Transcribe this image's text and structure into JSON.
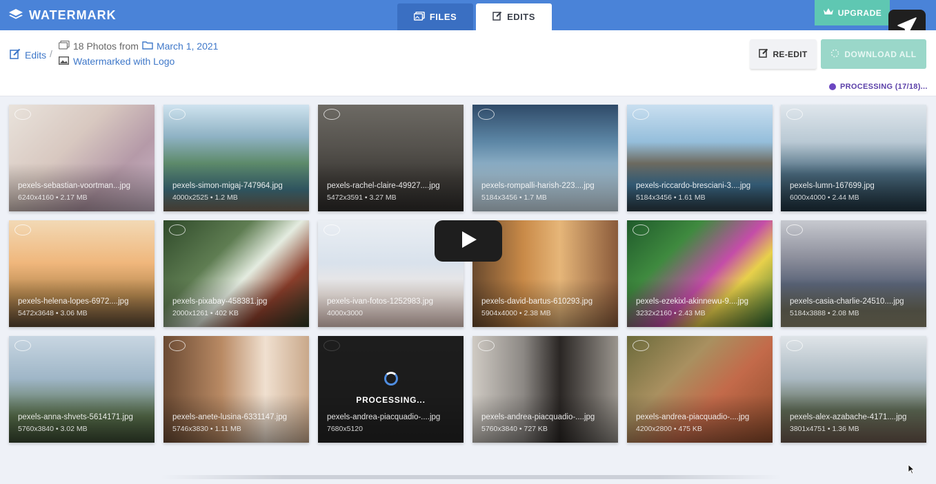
{
  "app": {
    "brand": "WATERMARK"
  },
  "tabs": [
    {
      "label": "FILES",
      "active": false
    },
    {
      "label": "EDITS",
      "active": true
    }
  ],
  "upgrade_label": "UPGRADE",
  "breadcrumb": {
    "edits_label": "Edits",
    "separator": "/",
    "photos_count_text": "18 Photos from",
    "date": "March 1, 2021",
    "preset": "Watermarked with Logo"
  },
  "actions": {
    "reedit": "RE-EDIT",
    "download_all": "DOWNLOAD ALL"
  },
  "status": {
    "processing": "PROCESSING (17/18)..."
  },
  "processing_card_label": "PROCESSING...",
  "colors": {
    "topbar": "#4a83d8",
    "accent_teal": "#5fc7b2",
    "status_purple": "#6b46c1",
    "link_blue": "#3f78c9"
  },
  "photos": [
    {
      "name": "pexels-sebastian-voortman...jpg",
      "meta": "6240x4160 • 2.17 MB",
      "processing": false
    },
    {
      "name": "pexels-simon-migaj-747964.jpg",
      "meta": "4000x2525 • 1.2 MB",
      "processing": false
    },
    {
      "name": "pexels-rachel-claire-49927....jpg",
      "meta": "5472x3591 • 3.27 MB",
      "processing": false
    },
    {
      "name": "pexels-rompalli-harish-223....jpg",
      "meta": "5184x3456 • 1.7 MB",
      "processing": false
    },
    {
      "name": "pexels-riccardo-bresciani-3....jpg",
      "meta": "5184x3456 • 1.61 MB",
      "processing": false
    },
    {
      "name": "pexels-lumn-167699.jpg",
      "meta": "6000x4000 • 2.44 MB",
      "processing": false
    },
    {
      "name": "pexels-helena-lopes-6972....jpg",
      "meta": "5472x3648 • 3.06 MB",
      "processing": false
    },
    {
      "name": "pexels-pixabay-458381.jpg",
      "meta": "2000x1261 • 402 KB",
      "processing": false
    },
    {
      "name": "pexels-ivan-fotos-1252983.jpg",
      "meta": "4000x3000",
      "processing": false
    },
    {
      "name": "pexels-david-bartus-610293.jpg",
      "meta": "5904x4000 • 2.38 MB",
      "processing": false
    },
    {
      "name": "pexels-ezekixl-akinnewu-9....jpg",
      "meta": "3232x2160 • 2.43 MB",
      "processing": false
    },
    {
      "name": "pexels-casia-charlie-24510....jpg",
      "meta": "5184x3888 • 2.08 MB",
      "processing": false
    },
    {
      "name": "pexels-anna-shvets-5614171.jpg",
      "meta": "5760x3840 • 3.02 MB",
      "processing": false
    },
    {
      "name": "pexels-anete-lusina-6331147.jpg",
      "meta": "5746x3830 • 1.11 MB",
      "processing": false
    },
    {
      "name": "pexels-andrea-piacquadio-....jpg",
      "meta": "7680x5120",
      "processing": true
    },
    {
      "name": "pexels-andrea-piacquadio-....jpg",
      "meta": "5760x3840 • 727 KB",
      "processing": false
    },
    {
      "name": "pexels-andrea-piacquadio-....jpg",
      "meta": "4200x2800 • 475 KB",
      "processing": false
    },
    {
      "name": "pexels-alex-azabache-4171....jpg",
      "meta": "3801x4751 • 1.36 MB",
      "processing": false
    }
  ]
}
